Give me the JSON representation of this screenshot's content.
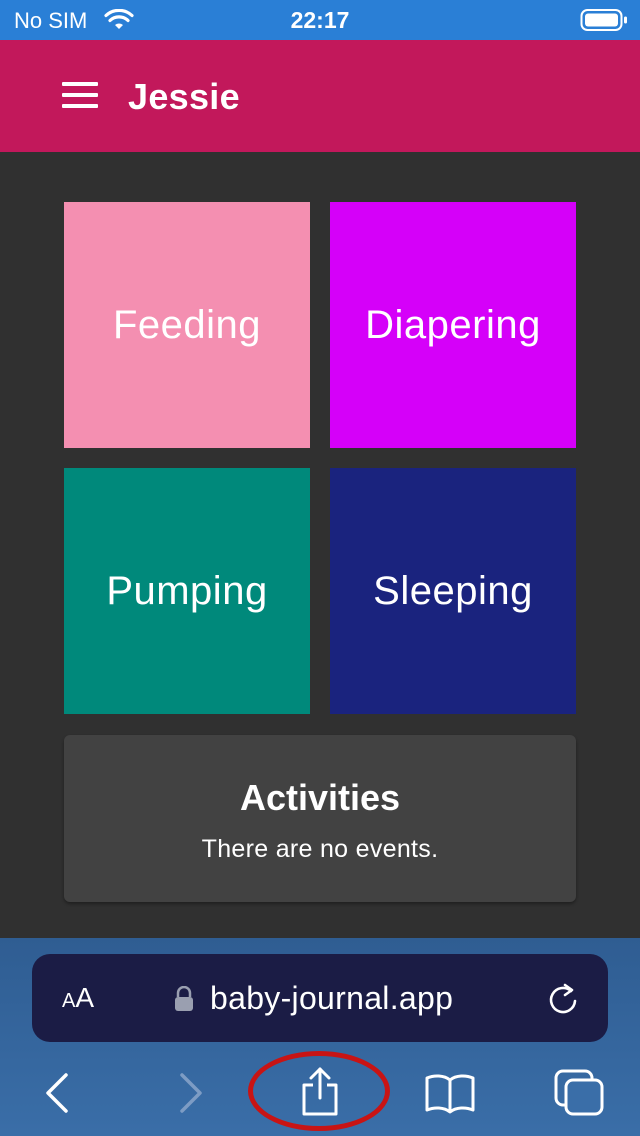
{
  "status_bar": {
    "carrier": "No SIM",
    "time": "22:17",
    "icons": [
      "wifi-icon",
      "battery-icon"
    ]
  },
  "app_bar": {
    "title": "Jessie",
    "menu_icon": "hamburger-menu-icon",
    "background": "#c2185b"
  },
  "tiles": [
    {
      "label": "Feeding",
      "color": "#f48fb1"
    },
    {
      "label": "Diapering",
      "color": "#d500f9"
    },
    {
      "label": "Pumping",
      "color": "#00897b"
    },
    {
      "label": "Sleeping",
      "color": "#1a237e"
    }
  ],
  "activities": {
    "heading": "Activities",
    "empty_text": "There are no events."
  },
  "browser": {
    "text_size_label": "AA",
    "url": "baby-journal.app",
    "icons": [
      "lock-icon",
      "reload-icon",
      "back-icon",
      "forward-icon",
      "share-icon",
      "bookmarks-icon",
      "tabs-icon"
    ]
  },
  "annotation": {
    "highlighted": "share-icon",
    "color": "#c81414"
  }
}
